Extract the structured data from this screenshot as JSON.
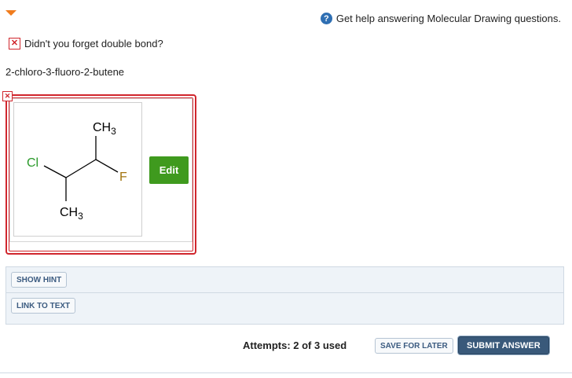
{
  "help": {
    "icon": "help-circle-icon",
    "text": "Get help answering Molecular Drawing questions."
  },
  "feedback": {
    "icon": "error-x-icon",
    "text": "Didn't you forget double bond?"
  },
  "question": {
    "text": "2-chloro-3-fluoro-2-butene"
  },
  "answer_status": {
    "icon": "incorrect-x-icon",
    "color": "#d0262d"
  },
  "molecule": {
    "labels": {
      "ch3_top": "CH",
      "ch3_top_sub": "3",
      "ch3_bottom": "CH",
      "ch3_bottom_sub": "3",
      "cl": "Cl",
      "f": "F"
    },
    "colors": {
      "cl": "#2a9a2a",
      "f": "#a2740f",
      "bond": "#000000"
    }
  },
  "edit_button": {
    "label": "Edit",
    "color": "#3f9a1e"
  },
  "hints": {
    "show_hint": "SHOW HINT",
    "link_to_text": "LINK TO TEXT"
  },
  "footer": {
    "attempts": "Attempts: 2 of 3 used",
    "save_for_later": "SAVE FOR LATER",
    "submit_answer": "SUBMIT ANSWER"
  },
  "colors": {
    "accent_orange": "#f07c1d",
    "error_red": "#d0262d",
    "submit_blue": "#39597a"
  }
}
